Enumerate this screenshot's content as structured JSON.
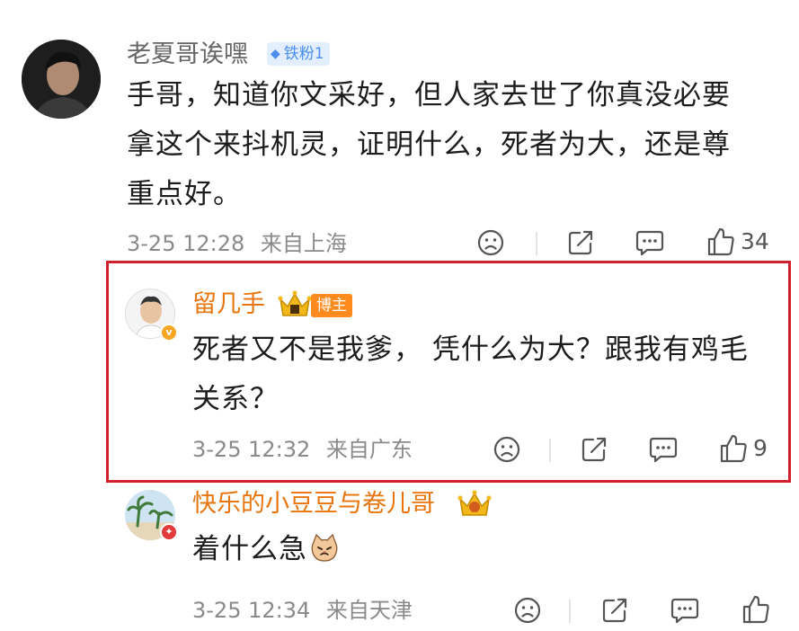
{
  "comments": [
    {
      "username": "老夏哥诶嘿",
      "fan_badge": "铁粉1",
      "text_lines": [
        "手哥，知道你文采好，但人家去世了你真没必要",
        "拿这个来抖机灵，证明什么，死者为大，还是尊",
        "重点好。"
      ],
      "time": "3-25 12:28",
      "location": "来自上海",
      "likes": "34"
    },
    {
      "username": "留几手",
      "host_badge": "博主",
      "text_lines": [
        "死者又不是我爹， 凭什么为大？跟我有鸡毛",
        "关系？"
      ],
      "time": "3-25 12:32",
      "location": "来自广东",
      "likes": "9"
    },
    {
      "username": "快乐的小豆豆与卷儿哥",
      "text": "着什么急",
      "time": "3-25 12:34",
      "location": "来自天津"
    }
  ],
  "colors": {
    "highlight": "#d0202d",
    "vip_name": "#e8740c",
    "host_badge": "#ff8a1e",
    "fan_badge_bg": "#e3efff",
    "fan_badge_text": "#4a8df0",
    "meta_text": "#8a8a8a"
  },
  "icons": [
    "sad-face-icon",
    "repost-icon",
    "comment-icon",
    "thumbs-up-icon",
    "crown-icon",
    "verified-v-icon",
    "cat-emoji-icon"
  ]
}
